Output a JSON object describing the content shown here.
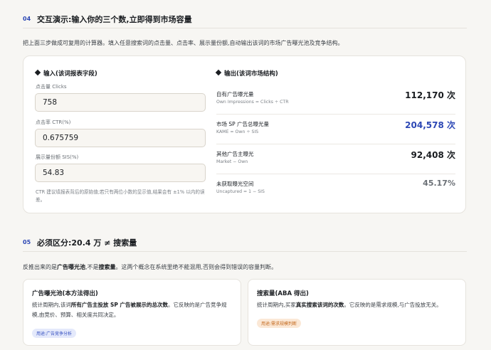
{
  "section4": {
    "num": "04",
    "title": "交互演示:输入你的三个数,立即得到市场容量",
    "desc": "把上面三步做成可复用的计算器。填入任意搜索词的点击量、点击率、展示量份额,自动输出该词的市场广告曝光池及竞争结构。"
  },
  "input_panel": {
    "title": "输入(该词报表字段)",
    "clicks_label": "点击量 Clicks",
    "clicks_value": "758",
    "ctr_label": "点击率 CTR(%)",
    "ctr_value": "0.675759",
    "sis_label": "展示量份额 SIS(%)",
    "sis_value": "54.83",
    "note": "CTR 建议填报表背后的原始值;若只有两位小数的显示值,结果会有 ±1% 以内的误差。"
  },
  "output_panel": {
    "title": "输出(该词市场结构)",
    "rows": [
      {
        "name": "自有广告曝光量",
        "formula": "Own Impressions = Clicks ÷ CTR",
        "value": "112,170 次"
      },
      {
        "name": "市场 SP 广告总曝光量",
        "formula": "KAME = Own ÷ SIS",
        "value": "204,578 次"
      },
      {
        "name": "其他广告主曝光",
        "formula": "Market − Own",
        "value": "92,408 次"
      },
      {
        "name": "未获取曝光空间",
        "formula": "Uncaptured = 1 − SIS",
        "value": "45.17%"
      }
    ]
  },
  "section5": {
    "num": "05",
    "title": "必须区分:20.4 万 ≠ 搜索量",
    "desc_1": "反推出来的是",
    "desc_b1": "广告曝光池",
    "desc_2": ",不是",
    "desc_b2": "搜索量",
    "desc_3": "。这两个概念在系统里绝不能混用,否则会得到错误的容量判断。"
  },
  "card_left": {
    "title": "广告曝光池(本方法得出)",
    "body_1": "统计周期内,该词",
    "body_b": "所有广告主投放 SP 广告被展示的总次数",
    "body_2": "。它反映的是广告竞争规模,由竞价、预算、相关度共同决定。",
    "tag": "用途:广告竞争分析"
  },
  "card_right": {
    "title": "搜索量(ABA 得出)",
    "body_1": "统计周期内,买家",
    "body_b": "真实搜索该词的次数",
    "body_2": "。它反映的是需求规模,与广告投放无关。",
    "tag": "用途:需求规模判断"
  },
  "colors": {
    "accent": "#2d48b5",
    "orange": "#c46a1f"
  }
}
